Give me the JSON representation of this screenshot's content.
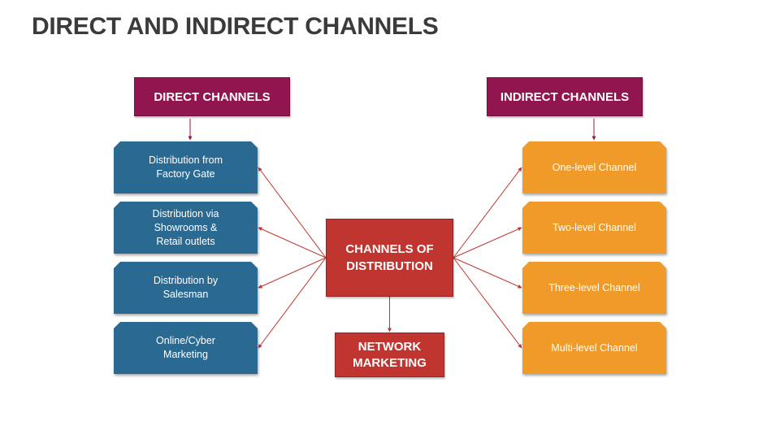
{
  "title": "DIRECT AND INDIRECT CHANNELS",
  "colors": {
    "header": "#91154e",
    "direct_node": "#2a6a92",
    "indirect_node": "#f09a2a",
    "center": "#c0352f",
    "connector": "#c0352f",
    "header_connector": "#91154e"
  },
  "direct": {
    "header": "DIRECT CHANNELS",
    "items": [
      {
        "lines": [
          "Distribution from",
          "Factory Gate"
        ]
      },
      {
        "lines": [
          "Distribution via",
          "Showrooms &",
          "Retail outlets"
        ]
      },
      {
        "lines": [
          "Distribution by",
          "Salesman"
        ]
      },
      {
        "lines": [
          "Online/Cyber",
          "Marketing"
        ]
      }
    ]
  },
  "indirect": {
    "header": "INDIRECT CHANNELS",
    "items": [
      {
        "lines": [
          "One-level Channel"
        ]
      },
      {
        "lines": [
          "Two-level Channel"
        ]
      },
      {
        "lines": [
          "Three-level Channel"
        ]
      },
      {
        "lines": [
          "Multi-level Channel"
        ]
      }
    ]
  },
  "center": {
    "lines": [
      "CHANNELS OF",
      "DISTRIBUTION"
    ]
  },
  "bottom": {
    "lines": [
      "NETWORK",
      "MARKETING"
    ]
  },
  "edges": [
    {
      "from": "center",
      "to": "direct-0"
    },
    {
      "from": "center",
      "to": "direct-1"
    },
    {
      "from": "center",
      "to": "direct-2"
    },
    {
      "from": "center",
      "to": "direct-3"
    },
    {
      "from": "center",
      "to": "indirect-0"
    },
    {
      "from": "center",
      "to": "indirect-1"
    },
    {
      "from": "center",
      "to": "indirect-2"
    },
    {
      "from": "center",
      "to": "indirect-3"
    },
    {
      "from": "center",
      "to": "bottom"
    },
    {
      "from": "direct-header",
      "to": "direct-0"
    },
    {
      "from": "indirect-header",
      "to": "indirect-0"
    }
  ]
}
